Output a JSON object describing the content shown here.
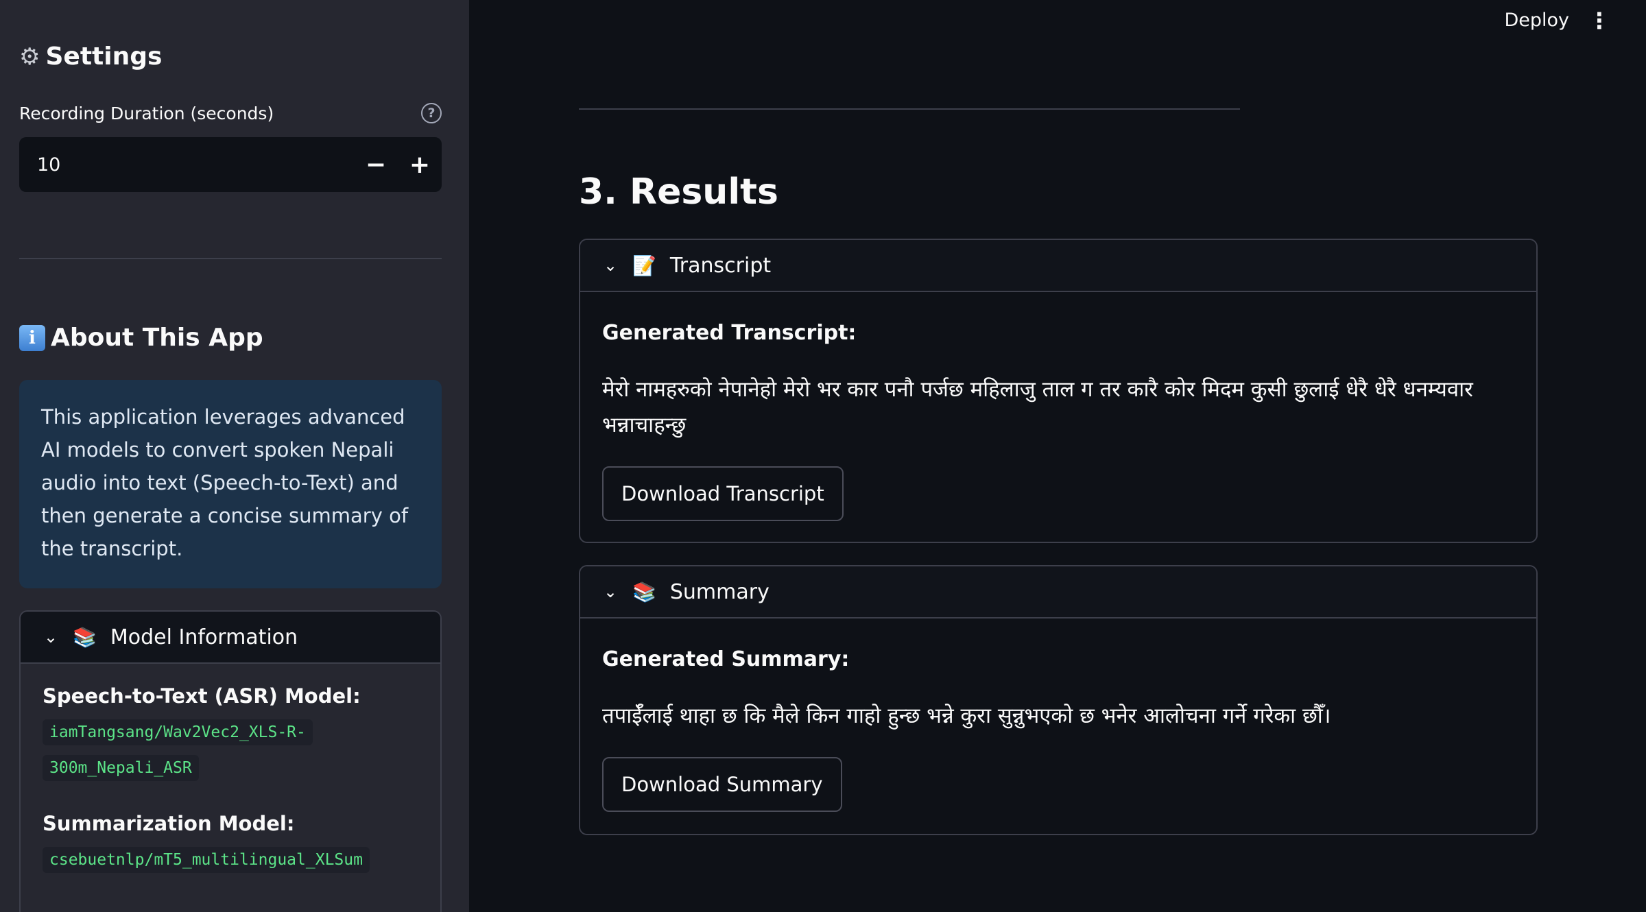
{
  "sidebar": {
    "settings_title": "Settings",
    "settings_icon": "gear-icon",
    "duration_label": "Recording Duration (seconds)",
    "duration_value": "10",
    "decrement": "−",
    "increment": "+",
    "about_title": "About This App",
    "about_icon": "info-icon",
    "about_text": "This application leverages advanced AI models to convert spoken Nepali audio into text (Speech-to-Text) and then generate a concise summary of the transcript.",
    "model_info": {
      "title": "Model Information",
      "icon": "books-icon",
      "asr_label": "Speech-to-Text (ASR) Model:",
      "asr_model": "iamTangsang/Wav2Vec2_XLS-R-300m_Nepali_ASR",
      "sum_label": "Summarization Model:",
      "sum_model": "csebuetnlp/mT5_multilingual_XLSum"
    }
  },
  "header": {
    "deploy": "Deploy",
    "menu_icon": "kebab-menu-icon"
  },
  "main": {
    "results_title": "3. Results",
    "transcript": {
      "title": "Transcript",
      "icon": "memo-icon",
      "heading": "Generated Transcript:",
      "text": "मेरो नामहरुको नेपानेहो मेरो भर कार पनौ पर्जछ महिलाजु ताल ग तर कारै कोर मिदम कुसी छुलाई धेरै धेरै धनम्यवार भन्नाचाहन्छु",
      "button": "Download Transcript"
    },
    "summary": {
      "title": "Summary",
      "icon": "books-icon",
      "heading": "Generated Summary:",
      "text": "तपाईँलाई थाहा छ कि मैले किन गाहो हुन्छ भन्ने कुरा सुन्नुभएको छ भनेर आलोचना गर्ने गरेका छौँ।",
      "button": "Download Summary"
    }
  },
  "colors": {
    "background": "#0e1117",
    "sidebar": "#262730",
    "info_box": "#1c3249",
    "code_text": "#5ce488"
  }
}
